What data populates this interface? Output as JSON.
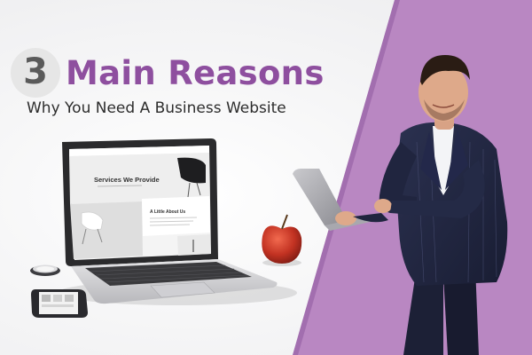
{
  "headline": {
    "number": "3",
    "title": "Main Reasons",
    "subtitle": "Why You Need A Business Website"
  },
  "laptop_screen": {
    "hero_heading": "Services We Provide",
    "card_heading": "A Little About Us"
  },
  "colors": {
    "accent_purple": "#b987c2",
    "title_purple": "#8e4f9f",
    "badge_gray": "#e6e6e6"
  }
}
